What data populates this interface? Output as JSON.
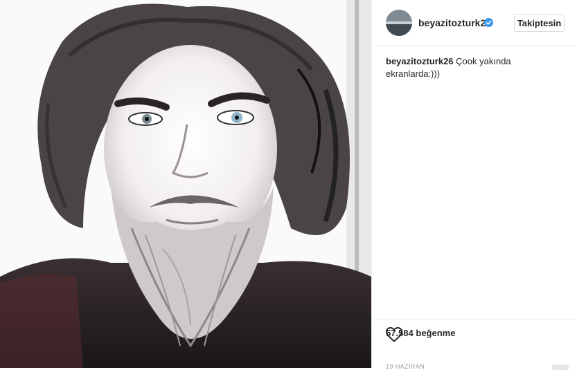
{
  "post": {
    "username": "beyazitozturk26",
    "verified_icon": "verified-badge-icon",
    "follow_label": "Takiptesin",
    "caption_user": "beyazitozturk26",
    "caption_text": "Çook yakında ekranlarda:)))",
    "likes": "57.584 beğenme",
    "date": "19 HAZİRAN",
    "like_icon": "heart-outline-icon"
  },
  "colors": {
    "accent_blue": "#3897f0",
    "border": "#efefef",
    "text": "#262626"
  }
}
